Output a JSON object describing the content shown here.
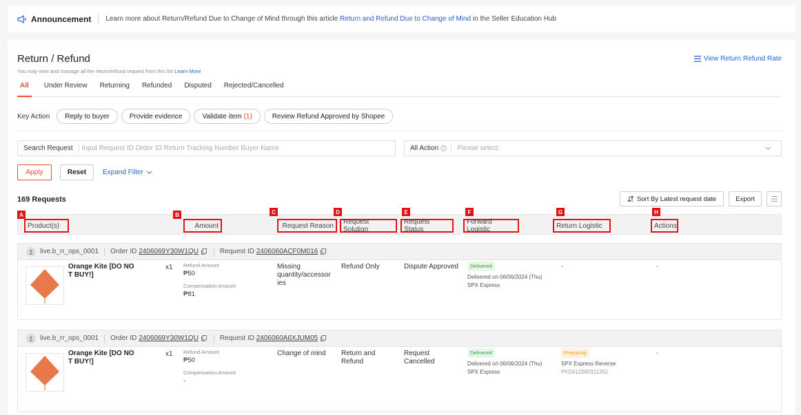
{
  "announcement": {
    "title": "Announcement",
    "text_before": "Learn more about Return/Refund Due to Change of Mind through this article ",
    "link": "Return and Refund Due to Change of Mind",
    "text_after": " in the Seller Education Hub"
  },
  "page": {
    "title": "Return / Refund",
    "subtitle": "You may view and manage all the return/refund request from this list ",
    "learn_more": "Learn More",
    "rate_link": "View Return Refund Rate"
  },
  "tabs": [
    "All",
    "Under Review",
    "Returning",
    "Refunded",
    "Disputed",
    "Rejected/Cancelled"
  ],
  "key_action": {
    "label": "Key Action",
    "pills": [
      {
        "label": "Reply to buyer",
        "count": ""
      },
      {
        "label": "Provide evidence",
        "count": ""
      },
      {
        "label": "Validate item",
        "count": "(1)"
      },
      {
        "label": "Review Refund Approved by Shopee",
        "count": ""
      }
    ]
  },
  "filters": {
    "search_label": "Search Request",
    "search_placeholder": "Input Request ID Order ID Return Tracking Number Buyer Name",
    "action_label": "All Action",
    "action_placeholder": "Please select",
    "apply": "Apply",
    "reset": "Reset",
    "expand": "Expand Filter"
  },
  "list": {
    "count_label": "169 Requests",
    "sort_label": "Sort By Latest request date",
    "export_label": "Export"
  },
  "columns": [
    {
      "badge": "A",
      "label": "Product(s)"
    },
    {
      "badge": "B",
      "label": "Amount"
    },
    {
      "badge": "C",
      "label": "Request Reason"
    },
    {
      "badge": "D",
      "label": "Request Solution"
    },
    {
      "badge": "E",
      "label": "Request Status"
    },
    {
      "badge": "F",
      "label": "Forward Logistic"
    },
    {
      "badge": "G",
      "label": "Return Logistic"
    },
    {
      "badge": "H",
      "label": "Actions"
    }
  ],
  "orders": [
    {
      "buyer": "live.b_rr_ops_0001",
      "order_id_label": "Order ID",
      "order_id": "2406069Y30W1QU",
      "request_id_label": "Request ID",
      "request_id": "2406060ACF0M016",
      "product_line1": "Orange Kite [DO NO",
      "product_line2": "T BUY!]",
      "qty": "x1",
      "refund_label": "Refund Amount",
      "refund_amount": "₱50",
      "comp_label": "Compensation Amount",
      "comp_amount": "₱81",
      "reason_lines": [
        "Missing",
        "quantity/accessor",
        "ies"
      ],
      "solution_lines": [
        "Refund Only"
      ],
      "status_lines": [
        "Dispute Approved"
      ],
      "forward_tag": "Delivered",
      "forward_date": "Delivered on 06/06/2024 (Thu)",
      "forward_carrier": "SPX Express",
      "return_tag": "",
      "return_text": "-",
      "return_carrier": "",
      "return_tracking": "",
      "actions": "-"
    },
    {
      "buyer": "live.b_rr_ops_0001",
      "order_id_label": "Order ID",
      "order_id": "2406069Y30W1QU",
      "request_id_label": "Request ID",
      "request_id": "2406060A6XJUM05",
      "product_line1": "Orange Kite [DO NO",
      "product_line2": "T BUY!]",
      "qty": "x1",
      "refund_label": "Refund Amount",
      "refund_amount": "₱50",
      "comp_label": "Compensation Amount",
      "comp_amount": "-",
      "reason_lines": [
        "Change of mind"
      ],
      "solution_lines": [
        "Return and",
        "Refund"
      ],
      "status_lines": [
        "Request",
        "Cancelled"
      ],
      "forward_tag": "Delivered",
      "forward_date": "Delivered on 06/06/2024 (Thu)",
      "forward_carrier": "SPX Express",
      "return_tag": "Preparing",
      "return_text": "",
      "return_carrier": "SPX Express Reverse",
      "return_tracking": "PH241228031139J",
      "actions": "-"
    }
  ],
  "colors": {
    "accent": "#ee4d2d",
    "link": "#2d63c8",
    "highlight_box": "#e21212",
    "product_kite": "#e8794a"
  }
}
